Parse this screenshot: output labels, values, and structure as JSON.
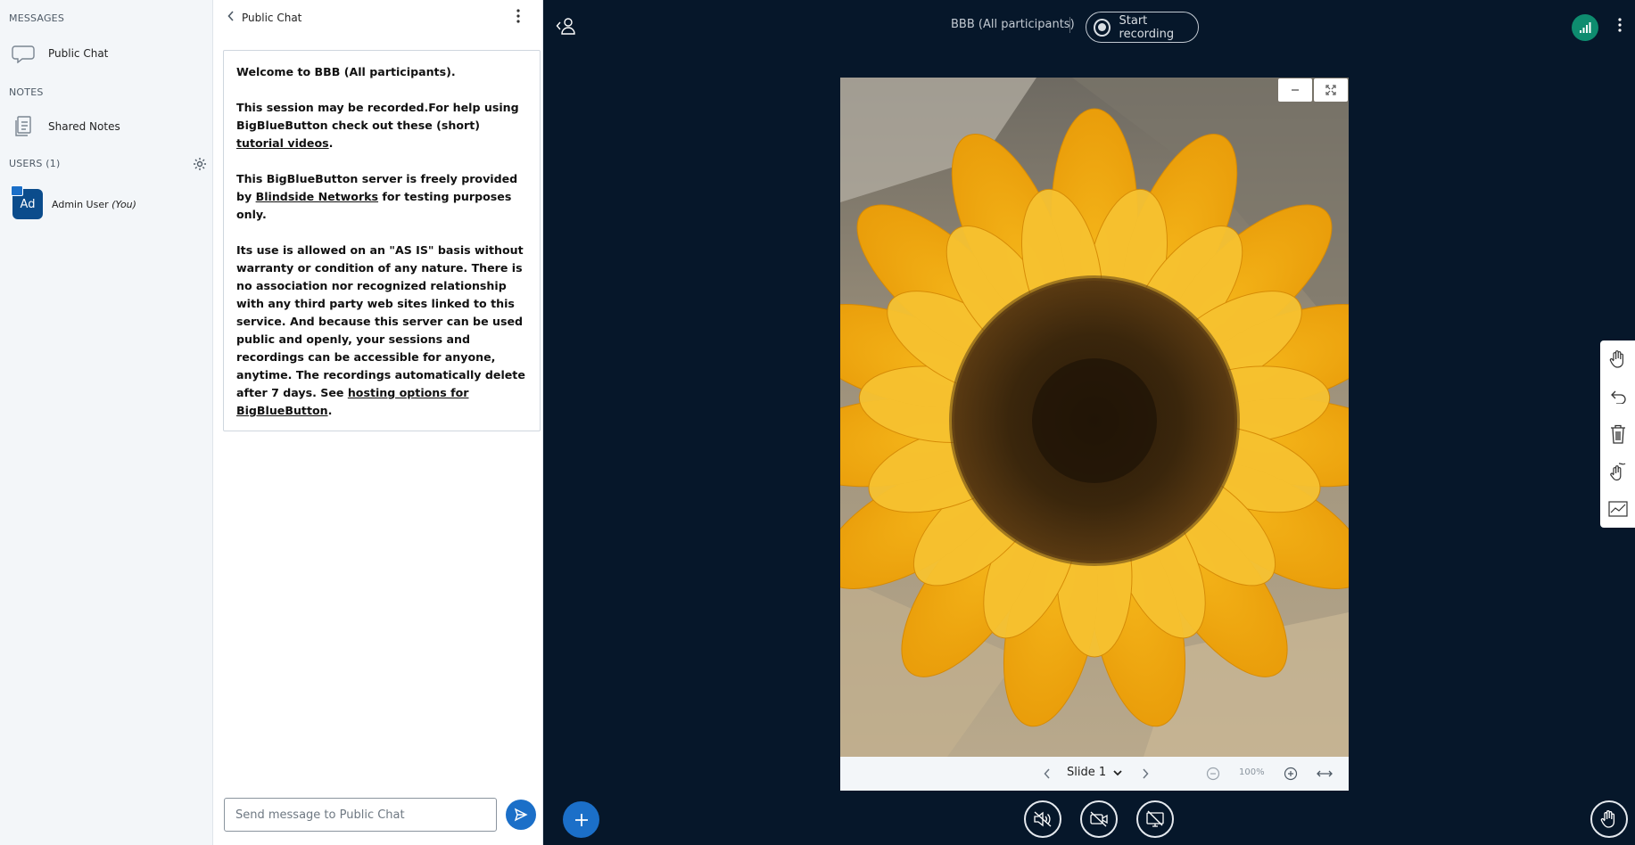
{
  "sidebar": {
    "messages_heading": "MESSAGES",
    "public_chat_label": "Public Chat",
    "notes_heading": "NOTES",
    "shared_notes_label": "Shared Notes",
    "users_heading": "USERS (1)",
    "users": [
      {
        "initials": "Ad",
        "name": "Admin User",
        "suffix": "(You)"
      }
    ]
  },
  "chat": {
    "title": "Public Chat",
    "welcome": {
      "line1": "Welcome to BBB (All participants).",
      "p2_a": "This session may be recorded.For help using BigBlueButton check out these (short) ",
      "p2_link": "tutorial videos",
      "p2_b": ".",
      "p3_a": "This BigBlueButton server is freely provided by ",
      "p3_link": "Blindside Networks",
      "p3_b": " for testing purposes only.",
      "p4_a": "Its use is allowed on an \"AS IS\" basis without warranty or condition of any nature. There is no association nor recognized relationship with any third party web sites linked to this service. And because this server can be used public and openly, your sessions and recordings can be accessible for anyone, anytime. The recordings automatically delete after 7 days. See ",
      "p4_link": "hosting options for BigBlueButton",
      "p4_b": "."
    },
    "input_placeholder": "Send message to Public Chat"
  },
  "topbar": {
    "meeting_title": "BBB (All participants)",
    "record_label": "Start recording"
  },
  "presentation": {
    "slide_label": "Slide 1",
    "zoom": "100%",
    "minimize_icon": "minus-icon",
    "fullscreen_icon": "fullscreen-icon"
  },
  "whiteboard_tools": [
    "hand-icon",
    "undo-icon",
    "trash-icon",
    "multi-user-icon",
    "chart-icon"
  ],
  "actionbar": {
    "buttons": [
      "plus-icon",
      "audio-mute-icon",
      "video-off-icon",
      "screenshare-off-icon",
      "raise-hand-icon"
    ]
  },
  "colors": {
    "background": "#06172a",
    "accent": "#1b6fc8",
    "connection": "#0e8c6f",
    "sidebar": "#f3f6f9"
  }
}
